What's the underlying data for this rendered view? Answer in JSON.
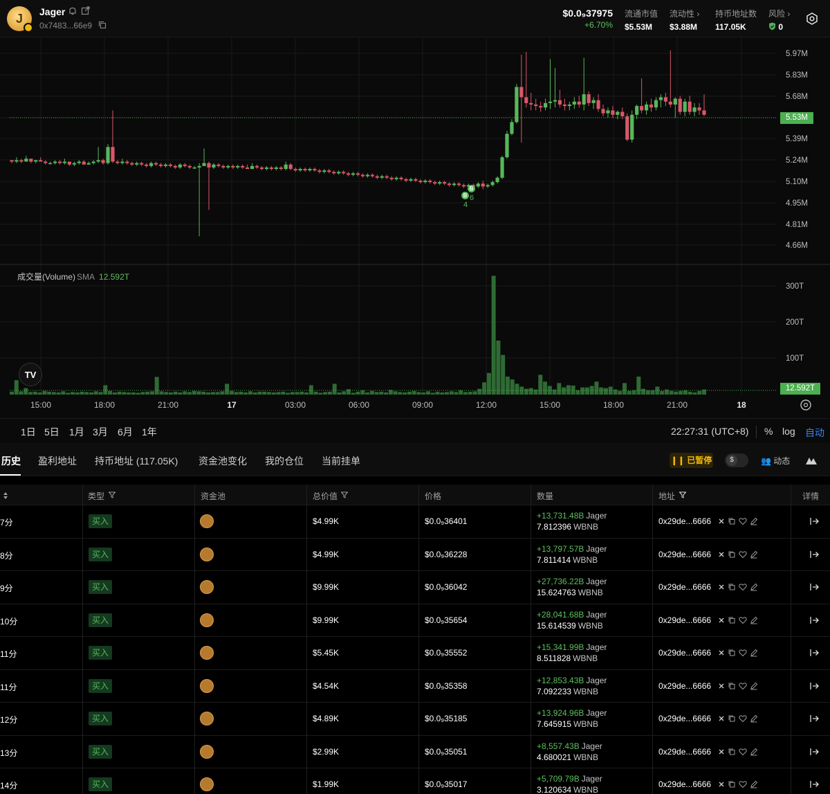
{
  "header": {
    "token_name": "Jager",
    "token_address": "0x7483...66e9",
    "price": "$0.0₉37975",
    "change": "+6.70%",
    "stats": [
      {
        "label": "流通市值",
        "value": "$5.53M",
        "arrow": false
      },
      {
        "label": "流动性",
        "value": "$3.88M",
        "arrow": true
      },
      {
        "label": "持币地址数",
        "value": "117.05K",
        "arrow": false
      },
      {
        "label": "风险",
        "value": "0",
        "arrow": true
      }
    ]
  },
  "chart_data": {
    "type": "candlestick",
    "y_axis_labels": [
      "5.97M",
      "5.83M",
      "5.68M",
      "5.53M",
      "5.39M",
      "5.24M",
      "5.10M",
      "4.95M",
      "4.81M",
      "4.66M"
    ],
    "x_axis_labels": [
      "15:00",
      "18:00",
      "21:00",
      "17",
      "03:00",
      "06:00",
      "09:00",
      "12:00",
      "15:00",
      "18:00",
      "21:00",
      "18"
    ],
    "current_price_tag": "5.53M",
    "volume_axis_labels": [
      "300T",
      "200T",
      "100T"
    ],
    "volume_sma_tag": "12.592T",
    "volume_title": "成交量(Volume)",
    "volume_sma_label": "SMA",
    "volume_sma_value": "12.592T",
    "trade_markers": [
      "B",
      "B"
    ],
    "trade_marker_counts": [
      "4",
      "6"
    ],
    "colors": {
      "up": "#57b85a",
      "down": "#d9576a"
    },
    "candles_mcap_m": [
      [
        5.24,
        5.24,
        5.22,
        5.23
      ],
      [
        5.23,
        5.26,
        5.22,
        5.24
      ],
      [
        5.24,
        5.25,
        5.22,
        5.23
      ],
      [
        5.23,
        5.27,
        5.23,
        5.25
      ],
      [
        5.25,
        5.25,
        5.22,
        5.23
      ],
      [
        5.23,
        5.24,
        5.22,
        5.24
      ],
      [
        5.24,
        5.26,
        5.23,
        5.23
      ],
      [
        5.23,
        5.24,
        5.21,
        5.22
      ],
      [
        5.22,
        5.23,
        5.21,
        5.22
      ],
      [
        5.22,
        5.24,
        5.21,
        5.23
      ],
      [
        5.23,
        5.24,
        5.21,
        5.22
      ],
      [
        5.22,
        5.25,
        5.21,
        5.23
      ],
      [
        5.23,
        5.23,
        5.2,
        5.21
      ],
      [
        5.21,
        5.23,
        5.2,
        5.22
      ],
      [
        5.22,
        5.24,
        5.21,
        5.23
      ],
      [
        5.23,
        5.24,
        5.21,
        5.21
      ],
      [
        5.21,
        5.23,
        5.21,
        5.22
      ],
      [
        5.22,
        5.24,
        5.21,
        5.23
      ],
      [
        5.23,
        5.33,
        5.22,
        5.24
      ],
      [
        5.24,
        5.25,
        5.21,
        5.22
      ],
      [
        5.22,
        5.35,
        5.21,
        5.33
      ],
      [
        5.33,
        5.58,
        5.22,
        5.23
      ],
      [
        5.23,
        5.24,
        5.21,
        5.22
      ],
      [
        5.22,
        5.25,
        5.21,
        5.23
      ],
      [
        5.23,
        5.24,
        5.21,
        5.22
      ],
      [
        5.22,
        5.23,
        5.2,
        5.21
      ],
      [
        5.21,
        5.23,
        5.2,
        5.22
      ],
      [
        5.22,
        5.23,
        5.2,
        5.21
      ],
      [
        5.21,
        5.22,
        5.19,
        5.2
      ],
      [
        5.2,
        5.23,
        5.19,
        5.22
      ],
      [
        5.22,
        5.23,
        5.2,
        5.21
      ],
      [
        5.21,
        5.22,
        5.19,
        5.2
      ],
      [
        5.2,
        5.22,
        5.19,
        5.21
      ],
      [
        5.21,
        5.22,
        5.19,
        5.2
      ],
      [
        5.2,
        5.21,
        5.18,
        5.19
      ],
      [
        5.19,
        5.22,
        5.18,
        5.21
      ],
      [
        5.21,
        5.22,
        5.19,
        5.2
      ],
      [
        5.2,
        5.21,
        5.18,
        5.19
      ],
      [
        5.19,
        5.2,
        5.18,
        5.19
      ],
      [
        5.19,
        5.22,
        4.72,
        5.2
      ],
      [
        5.2,
        5.32,
        5.2,
        5.22
      ],
      [
        5.22,
        5.23,
        4.9,
        5.19
      ],
      [
        5.19,
        5.22,
        5.18,
        5.21
      ],
      [
        5.21,
        5.22,
        5.19,
        5.2
      ],
      [
        5.2,
        5.21,
        5.18,
        5.19
      ],
      [
        5.19,
        5.21,
        5.18,
        5.2
      ],
      [
        5.2,
        5.21,
        5.18,
        5.19
      ],
      [
        5.19,
        5.21,
        5.18,
        5.2
      ],
      [
        5.2,
        5.21,
        5.18,
        5.19
      ],
      [
        5.19,
        5.21,
        5.18,
        5.18
      ],
      [
        5.18,
        5.22,
        5.18,
        5.2
      ],
      [
        5.2,
        5.21,
        5.18,
        5.19
      ],
      [
        5.19,
        5.2,
        5.17,
        5.18
      ],
      [
        5.18,
        5.2,
        5.17,
        5.19
      ],
      [
        5.19,
        5.2,
        5.17,
        5.18
      ],
      [
        5.18,
        5.2,
        5.17,
        5.19
      ],
      [
        5.19,
        5.2,
        5.17,
        5.18
      ],
      [
        5.18,
        5.23,
        5.17,
        5.21
      ],
      [
        5.21,
        5.22,
        5.17,
        5.18
      ],
      [
        5.18,
        5.19,
        5.16,
        5.17
      ],
      [
        5.17,
        5.19,
        5.16,
        5.18
      ],
      [
        5.18,
        5.19,
        5.16,
        5.17
      ],
      [
        5.17,
        5.19,
        5.16,
        5.18
      ],
      [
        5.18,
        5.19,
        5.16,
        5.17
      ],
      [
        5.17,
        5.18,
        5.15,
        5.16
      ],
      [
        5.16,
        5.18,
        5.15,
        5.17
      ],
      [
        5.17,
        5.18,
        5.15,
        5.16
      ],
      [
        5.16,
        5.17,
        5.14,
        5.15
      ],
      [
        5.15,
        5.17,
        5.14,
        5.16
      ],
      [
        5.16,
        5.17,
        5.14,
        5.15
      ],
      [
        5.15,
        5.16,
        5.13,
        5.14
      ],
      [
        5.14,
        5.16,
        5.13,
        5.15
      ],
      [
        5.15,
        5.16,
        5.13,
        5.14
      ],
      [
        5.14,
        5.15,
        5.12,
        5.13
      ],
      [
        5.13,
        5.15,
        5.12,
        5.14
      ],
      [
        5.14,
        5.15,
        5.12,
        5.13
      ],
      [
        5.13,
        5.14,
        5.11,
        5.12
      ],
      [
        5.12,
        5.14,
        5.11,
        5.13
      ],
      [
        5.13,
        5.14,
        5.11,
        5.12
      ],
      [
        5.12,
        5.13,
        5.1,
        5.11
      ],
      [
        5.11,
        5.13,
        5.1,
        5.12
      ],
      [
        5.12,
        5.13,
        5.1,
        5.11
      ],
      [
        5.11,
        5.12,
        5.09,
        5.1
      ],
      [
        5.1,
        5.12,
        5.09,
        5.11
      ],
      [
        5.11,
        5.12,
        5.09,
        5.1
      ],
      [
        5.1,
        5.11,
        5.08,
        5.09
      ],
      [
        5.09,
        5.11,
        5.08,
        5.1
      ],
      [
        5.1,
        5.11,
        5.08,
        5.09
      ],
      [
        5.09,
        5.1,
        5.07,
        5.08
      ],
      [
        5.08,
        5.1,
        5.07,
        5.09
      ],
      [
        5.09,
        5.1,
        5.07,
        5.08
      ],
      [
        5.08,
        5.09,
        5.06,
        5.07
      ],
      [
        5.07,
        5.09,
        5.06,
        5.08
      ],
      [
        5.08,
        5.09,
        5.06,
        5.07
      ],
      [
        5.07,
        5.08,
        5.05,
        5.06
      ],
      [
        5.06,
        5.08,
        5.05,
        5.07
      ],
      [
        5.07,
        5.08,
        5.05,
        5.06
      ],
      [
        5.06,
        5.09,
        5.05,
        5.08
      ],
      [
        5.08,
        5.1,
        5.04,
        5.06
      ],
      [
        5.06,
        5.08,
        5.05,
        5.07
      ],
      [
        5.07,
        5.1,
        5.06,
        5.09
      ],
      [
        5.09,
        5.13,
        5.08,
        5.12
      ],
      [
        5.12,
        5.27,
        5.11,
        5.26
      ],
      [
        5.26,
        5.44,
        5.25,
        5.42
      ],
      [
        5.42,
        5.52,
        5.41,
        5.5
      ],
      [
        5.5,
        5.76,
        5.49,
        5.74
      ],
      [
        5.74,
        5.96,
        5.36,
        5.67
      ],
      [
        5.67,
        5.98,
        5.6,
        5.63
      ],
      [
        5.63,
        5.7,
        5.58,
        5.62
      ],
      [
        5.62,
        5.66,
        5.58,
        5.61
      ],
      [
        5.61,
        5.64,
        5.57,
        5.6
      ],
      [
        5.6,
        5.66,
        5.58,
        5.63
      ],
      [
        5.63,
        5.93,
        5.59,
        5.64
      ],
      [
        5.64,
        5.87,
        5.6,
        5.65
      ],
      [
        5.65,
        5.72,
        5.6,
        5.62
      ],
      [
        5.62,
        5.66,
        5.58,
        5.61
      ],
      [
        5.61,
        5.64,
        5.58,
        5.62
      ],
      [
        5.62,
        5.67,
        5.59,
        5.64
      ],
      [
        5.64,
        5.68,
        5.6,
        5.62
      ],
      [
        5.62,
        5.94,
        5.58,
        5.69
      ],
      [
        5.69,
        5.71,
        5.61,
        5.63
      ],
      [
        5.63,
        5.67,
        5.59,
        5.65
      ],
      [
        5.65,
        5.69,
        5.57,
        5.59
      ],
      [
        5.59,
        5.62,
        5.54,
        5.56
      ],
      [
        5.56,
        5.6,
        5.53,
        5.58
      ],
      [
        5.58,
        5.61,
        5.53,
        5.55
      ],
      [
        5.55,
        5.58,
        5.52,
        5.57
      ],
      [
        5.57,
        5.6,
        5.52,
        5.54
      ],
      [
        5.54,
        5.56,
        5.37,
        5.38
      ],
      [
        5.38,
        5.58,
        5.36,
        5.55
      ],
      [
        5.55,
        5.62,
        5.52,
        5.61
      ],
      [
        5.61,
        5.8,
        5.56,
        5.58
      ],
      [
        5.58,
        5.64,
        5.55,
        5.62
      ],
      [
        5.62,
        5.66,
        5.57,
        5.6
      ],
      [
        5.6,
        5.67,
        5.58,
        5.65
      ],
      [
        5.65,
        5.69,
        5.6,
        5.67
      ],
      [
        5.67,
        5.7,
        5.61,
        5.64
      ],
      [
        5.64,
        5.99,
        5.6,
        5.62
      ],
      [
        5.62,
        5.67,
        5.53,
        5.66
      ],
      [
        5.66,
        5.68,
        5.55,
        5.57
      ],
      [
        5.57,
        5.66,
        5.54,
        5.64
      ],
      [
        5.64,
        5.68,
        5.55,
        5.57
      ],
      [
        5.57,
        5.63,
        5.54,
        5.6
      ],
      [
        5.6,
        5.63,
        5.55,
        5.58
      ],
      [
        5.58,
        5.69,
        5.54,
        5.55
      ]
    ],
    "volumes_t": [
      8,
      40,
      9,
      18,
      7,
      8,
      6,
      10,
      8,
      7,
      6,
      9,
      5,
      7,
      6,
      8,
      7,
      6,
      9,
      7,
      26,
      10,
      6,
      8,
      7,
      6,
      6,
      5,
      7,
      8,
      9,
      49,
      9,
      7,
      6,
      8,
      6,
      9,
      7,
      10,
      9,
      8,
      6,
      7,
      7,
      9,
      30,
      10,
      7,
      8,
      6,
      9,
      6,
      8,
      8,
      7,
      6,
      7,
      8,
      5,
      7,
      7,
      8,
      6,
      26,
      8,
      5,
      7,
      8,
      30,
      6,
      9,
      15,
      5,
      8,
      12,
      6,
      10,
      7,
      8,
      6,
      13,
      9,
      7,
      6,
      8,
      10,
      7,
      6,
      9,
      5,
      8,
      6,
      7,
      9,
      7,
      12,
      7,
      8,
      9,
      16,
      34,
      60,
      330,
      150,
      110,
      50,
      42,
      30,
      22,
      16,
      18,
      14,
      55,
      36,
      24,
      14,
      32,
      20,
      26,
      25,
      12,
      20,
      20,
      24,
      36,
      20,
      18,
      22,
      14,
      10,
      32,
      10,
      12,
      50,
      16,
      12,
      12,
      22,
      10,
      14,
      10,
      8,
      10,
      12,
      8,
      6,
      10,
      14
    ]
  },
  "range_bar": {
    "ranges": [
      "1日",
      "5日",
      "1月",
      "3月",
      "6月",
      "1年"
    ],
    "timestamp": "22:27:31 (UTC+8)",
    "options": [
      "%",
      "log",
      "自动"
    ]
  },
  "tabs": {
    "items": [
      "历史",
      "盈利地址",
      "持币地址 (117.05K)",
      "资金池变化",
      "我的仓位",
      "当前挂单"
    ],
    "paused_label": "已暂停",
    "toggle_symbol": "$",
    "dynamics_label": "动态"
  },
  "table": {
    "columns": [
      "类型",
      "资金池",
      "总价值",
      "价格",
      "数量",
      "地址",
      "详情"
    ],
    "rows": [
      {
        "time": "7分",
        "type": "买入",
        "value": "$4.99K",
        "price": "$0.0₉36401",
        "amount": "+13,731.48B",
        "token": "Jager",
        "bnb": "7.812396",
        "bnb_token": "WBNB",
        "address": "0x29de...6666"
      },
      {
        "time": "8分",
        "type": "买入",
        "value": "$4.99K",
        "price": "$0.0₉36228",
        "amount": "+13,797.57B",
        "token": "Jager",
        "bnb": "7.811414",
        "bnb_token": "WBNB",
        "address": "0x29de...6666"
      },
      {
        "time": "9分",
        "type": "买入",
        "value": "$9.99K",
        "price": "$0.0₉36042",
        "amount": "+27,736.22B",
        "token": "Jager",
        "bnb": "15.624763",
        "bnb_token": "WBNB",
        "address": "0x29de...6666"
      },
      {
        "time": "10分",
        "type": "买入",
        "value": "$9.99K",
        "price": "$0.0₉35654",
        "amount": "+28,041.68B",
        "token": "Jager",
        "bnb": "15.614539",
        "bnb_token": "WBNB",
        "address": "0x29de...6666"
      },
      {
        "time": "11分",
        "type": "买入",
        "value": "$5.45K",
        "price": "$0.0₉35552",
        "amount": "+15,341.99B",
        "token": "Jager",
        "bnb": "8.511828",
        "bnb_token": "WBNB",
        "address": "0x29de...6666"
      },
      {
        "time": "11分",
        "type": "买入",
        "value": "$4.54K",
        "price": "$0.0₉35358",
        "amount": "+12,853.43B",
        "token": "Jager",
        "bnb": "7.092233",
        "bnb_token": "WBNB",
        "address": "0x29de...6666"
      },
      {
        "time": "12分",
        "type": "买入",
        "value": "$4.89K",
        "price": "$0.0₉35185",
        "amount": "+13,924.96B",
        "token": "Jager",
        "bnb": "7.645915",
        "bnb_token": "WBNB",
        "address": "0x29de...6666"
      },
      {
        "time": "13分",
        "type": "买入",
        "value": "$2.99K",
        "price": "$0.0₉35051",
        "amount": "+8,557.43B",
        "token": "Jager",
        "bnb": "4.680021",
        "bnb_token": "WBNB",
        "address": "0x29de...6666"
      },
      {
        "time": "14分",
        "type": "买入",
        "value": "$1.99K",
        "price": "$0.0₉35017",
        "amount": "+5,709.79B",
        "token": "Jager",
        "bnb": "3.120634",
        "bnb_token": "WBNB",
        "address": "0x29de...6666"
      }
    ]
  }
}
